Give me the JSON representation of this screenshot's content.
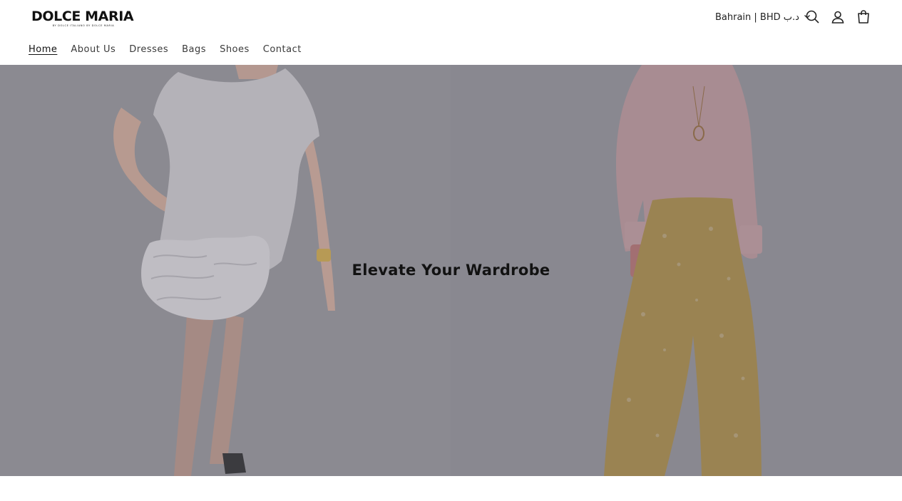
{
  "header": {
    "logo_text": "DOLCE MARIA",
    "logo_tagline": "BY DOLCE ITALIANO BY DOLCE MARIA",
    "locale_label": "Bahrain | BHD د.ب",
    "icons": [
      "search-icon",
      "account-icon",
      "cart-icon"
    ]
  },
  "nav": {
    "items": [
      {
        "label": "Home",
        "active": true
      },
      {
        "label": "About Us",
        "active": false
      },
      {
        "label": "Dresses",
        "active": false
      },
      {
        "label": "Bags",
        "active": false
      },
      {
        "label": "Shoes",
        "active": false
      },
      {
        "label": "Contact",
        "active": false
      }
    ]
  },
  "hero": {
    "title": "Elevate Your Wardrobe",
    "overlay_color": "#8a8990"
  }
}
